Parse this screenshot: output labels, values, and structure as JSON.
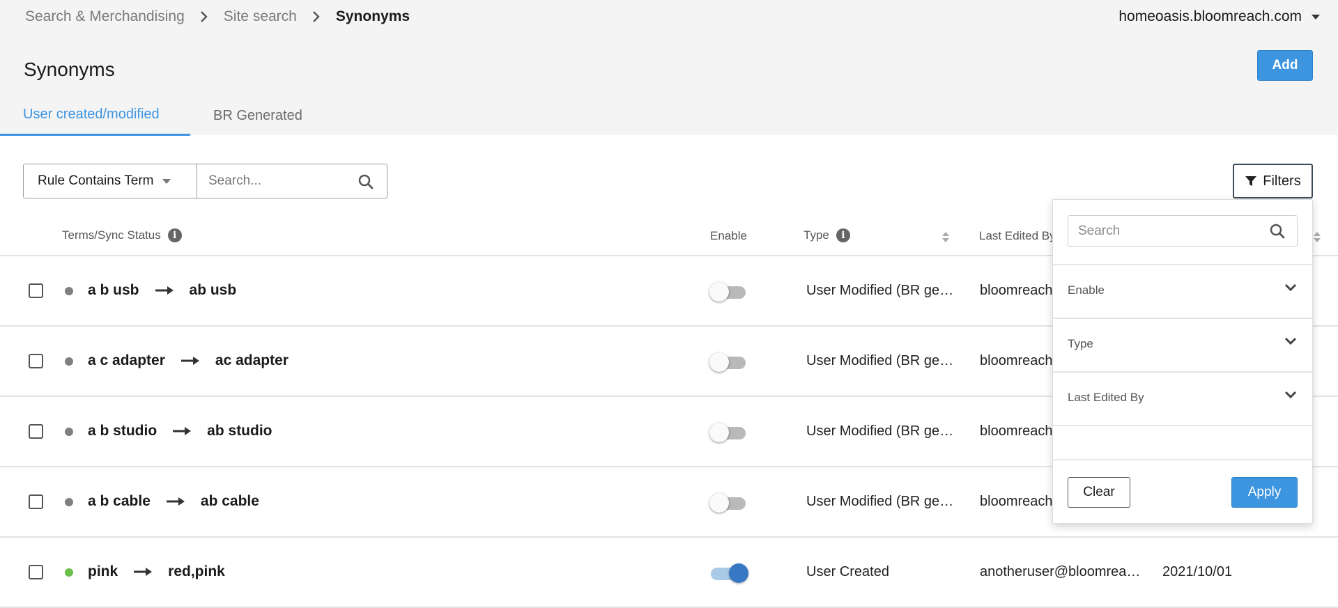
{
  "breadcrumb": [
    "Search & Merchandising",
    "Site search",
    "Synonyms"
  ],
  "account": {
    "domain": "homeoasis.bloomreach.com"
  },
  "page": {
    "title": "Synonyms",
    "add_label": "Add"
  },
  "tabs": [
    {
      "label": "User created/modified",
      "active": true
    },
    {
      "label": "BR Generated",
      "active": false
    }
  ],
  "filter_bar": {
    "rule_select": "Rule Contains Term",
    "search_placeholder": "Search...",
    "filters_label": "Filters"
  },
  "table": {
    "columns": {
      "terms": "Terms/Sync Status",
      "enable": "Enable",
      "type": "Type",
      "last_edited_by": "Last Edited By"
    },
    "rows": [
      {
        "from": "a b usb",
        "to": "ab usb",
        "status_color": "#7f7f7f",
        "enabled": false,
        "type": "User Modified (BR generated)",
        "editor": "bloomreach",
        "date": ""
      },
      {
        "from": "a c adapter",
        "to": "ac adapter",
        "status_color": "#7f7f7f",
        "enabled": false,
        "type": "User Modified (BR generated)",
        "editor": "bloomreach",
        "date": ""
      },
      {
        "from": "a b studio",
        "to": "ab studio",
        "status_color": "#7f7f7f",
        "enabled": false,
        "type": "User Modified (BR generated)",
        "editor": "bloomreach",
        "date": ""
      },
      {
        "from": "a b cable",
        "to": "ab cable",
        "status_color": "#7f7f7f",
        "enabled": false,
        "type": "User Modified (BR generated)",
        "editor": "bloomreach",
        "date": ""
      },
      {
        "from": "pink",
        "to": "red,pink",
        "status_color": "#6cc04a",
        "enabled": true,
        "type": "User Created",
        "editor": "anotheruser@bloomreach.com",
        "date": "2021/10/01"
      }
    ]
  },
  "filter_panel": {
    "search_placeholder": "Search",
    "sections": [
      "Enable",
      "Type",
      "Last Edited By"
    ],
    "clear_label": "Clear",
    "apply_label": "Apply"
  },
  "colors": {
    "accent": "#3d95e0",
    "status_active": "#6cc04a",
    "status_inactive": "#7f7f7f"
  }
}
